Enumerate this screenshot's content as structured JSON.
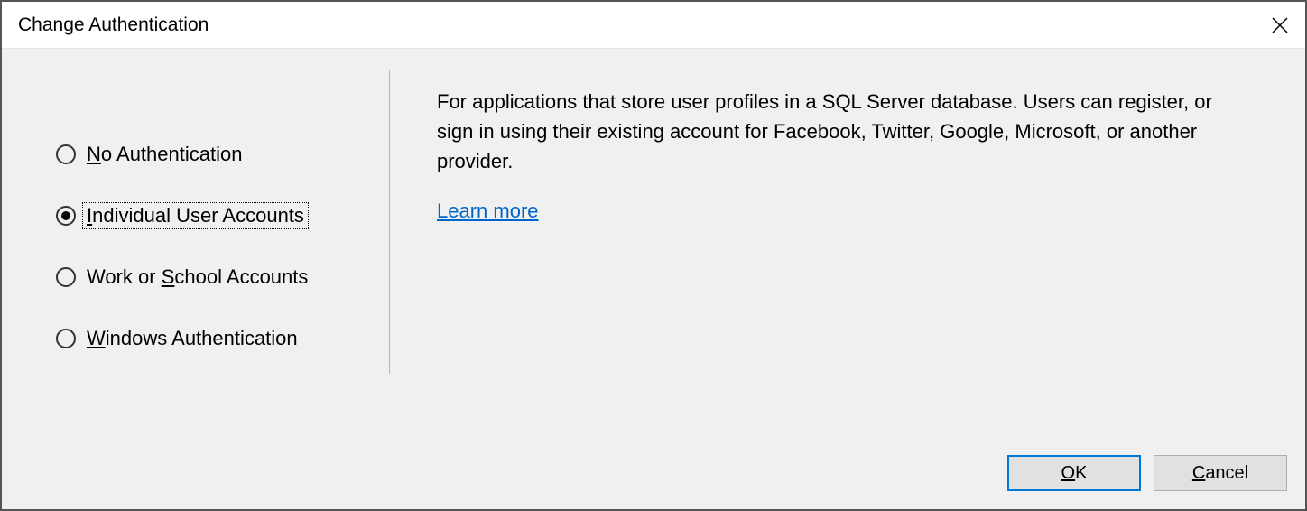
{
  "dialog": {
    "title": "Change Authentication",
    "options": [
      {
        "label": "No Authentication",
        "accelIndex": 0,
        "selected": false
      },
      {
        "label": "Individual User Accounts",
        "accelIndex": 0,
        "selected": true
      },
      {
        "label": "Work or School Accounts",
        "accelIndex": 8,
        "selected": false
      },
      {
        "label": "Windows Authentication",
        "accelIndex": 0,
        "selected": false
      }
    ],
    "description": "For applications that store user profiles in a SQL Server database. Users can register, or sign in using their existing account for Facebook, Twitter, Google, Microsoft, or another provider.",
    "learnMore": "Learn more",
    "buttons": {
      "ok": "OK",
      "cancel": "Cancel"
    }
  }
}
